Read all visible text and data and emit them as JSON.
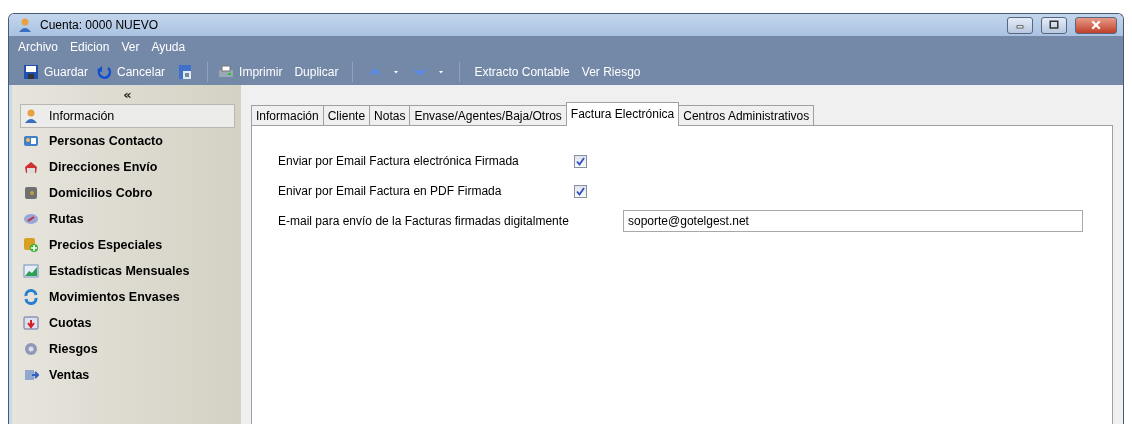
{
  "window": {
    "title": "Cuenta: 0000 NUEVO"
  },
  "menu": [
    "Archivo",
    "Edicion",
    "Ver",
    "Ayuda"
  ],
  "toolbar": [
    {
      "kind": "button",
      "label": "Guardar"
    },
    {
      "kind": "button",
      "label": "Cancelar"
    },
    {
      "kind": "icon"
    },
    {
      "kind": "separator"
    },
    {
      "kind": "button",
      "label": "Imprimir"
    },
    {
      "kind": "button",
      "label": "Duplicar"
    },
    {
      "kind": "separator"
    },
    {
      "kind": "dropdown"
    },
    {
      "kind": "dropdown"
    },
    {
      "kind": "separator"
    },
    {
      "kind": "button",
      "label": "Extracto Contable"
    },
    {
      "kind": "button",
      "label": "Ver Riesgo"
    }
  ],
  "sidebar": {
    "collapse": "«",
    "items": [
      {
        "label": "Información",
        "selected": true
      },
      {
        "label": "Personas Contacto",
        "selected": false
      },
      {
        "label": "Direcciones Envío",
        "selected": false
      },
      {
        "label": "Domicilios Cobro",
        "selected": false
      },
      {
        "label": "Rutas",
        "selected": false
      },
      {
        "label": "Precios Especiales",
        "selected": false
      },
      {
        "label": "Estadísticas Mensuales",
        "selected": false
      },
      {
        "label": "Movimientos Envases",
        "selected": false
      },
      {
        "label": "Cuotas",
        "selected": false
      },
      {
        "label": "Riesgos",
        "selected": false
      },
      {
        "label": "Ventas",
        "selected": false
      }
    ]
  },
  "tabs": [
    {
      "label": "Información",
      "selected": false
    },
    {
      "label": "Cliente",
      "selected": false
    },
    {
      "label": "Notas",
      "selected": false
    },
    {
      "label": "Envase/Agentes/Baja/Otros",
      "selected": false
    },
    {
      "label": "Factura Electrónica",
      "selected": true
    },
    {
      "label": "Centros Administrativos",
      "selected": false
    }
  ],
  "form": [
    {
      "kind": "checkbox",
      "label": "Enviar por Email Factura electrónica Firmada",
      "checked": true
    },
    {
      "kind": "checkbox",
      "label": "Enivar por Email Factura en PDF Firmada",
      "checked": true
    },
    {
      "kind": "text",
      "label": "E-mail para envío de la Facturas firmadas digitalmente",
      "value": "soporte@gotelgest.net"
    }
  ]
}
